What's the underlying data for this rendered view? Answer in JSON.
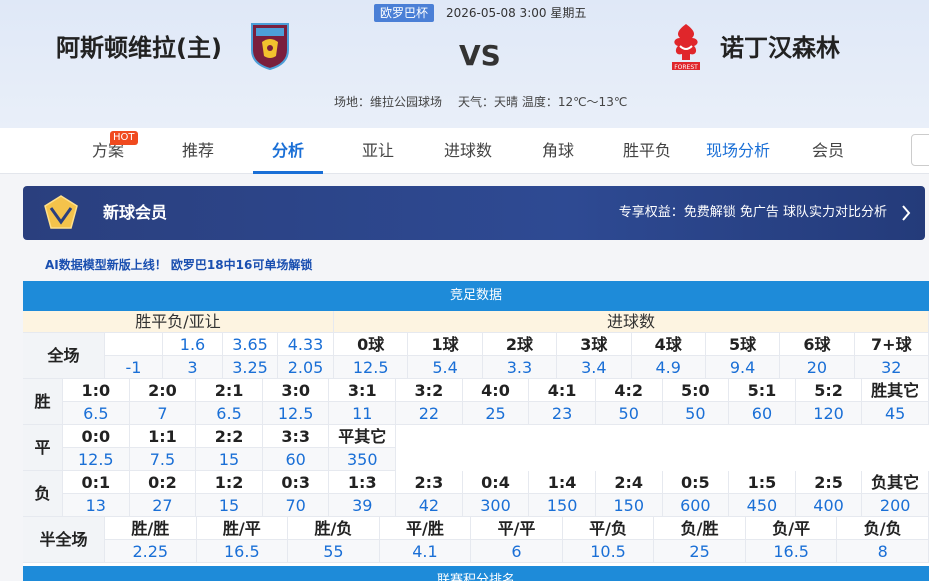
{
  "match": {
    "league": "欧罗巴杯",
    "datetime": "2026-05-08 3:00 星期五",
    "home": "阿斯顿维拉(主)",
    "away": "诺丁汉森林",
    "vs": "VS",
    "venue": "场地：维拉公园球场",
    "weather": "天气：天晴 温度：12℃～13℃"
  },
  "nav": {
    "hot": "HOT",
    "tabs": [
      "方案",
      "推荐",
      "分析",
      "亚让",
      "进球数",
      "角球",
      "胜平负",
      "现场分析",
      "会员"
    ],
    "active": "分析"
  },
  "vip": {
    "title": "新球会员",
    "perks": "专享权益：免费解锁 免广告 球队实力对比分析"
  },
  "promo": "AI数据模型新版上线！ 欧罗巴18中16可单场解锁",
  "jingzu": {
    "title": "竞足数据",
    "spf_header": "胜平负/亚让",
    "goals_header": "进球数",
    "full_label": "全场",
    "spf_row1": [
      "",
      "1.6",
      "3.65",
      "4.33"
    ],
    "spf_row2": [
      "-1",
      "3",
      "3.25",
      "2.05"
    ],
    "goal_labels": [
      "0球",
      "1球",
      "2球",
      "3球",
      "4球",
      "5球",
      "6球",
      "7+球"
    ],
    "goal_odds": [
      "12.5",
      "5.4",
      "3.3",
      "3.4",
      "4.9",
      "9.4",
      "20",
      "32"
    ],
    "win_label": "胜",
    "win_scores": [
      "1:0",
      "2:0",
      "2:1",
      "3:0",
      "3:1",
      "3:2",
      "4:0",
      "4:1",
      "4:2",
      "5:0",
      "5:1",
      "5:2",
      "胜其它"
    ],
    "win_odds": [
      "6.5",
      "7",
      "6.5",
      "12.5",
      "11",
      "22",
      "25",
      "23",
      "50",
      "50",
      "60",
      "120",
      "45"
    ],
    "draw_label": "平",
    "draw_scores": [
      "0:0",
      "1:1",
      "2:2",
      "3:3",
      "平其它"
    ],
    "draw_odds": [
      "12.5",
      "7.5",
      "15",
      "60",
      "350"
    ],
    "lose_label": "负",
    "lose_scores": [
      "0:1",
      "0:2",
      "1:2",
      "0:3",
      "1:3",
      "2:3",
      "0:4",
      "1:4",
      "2:4",
      "0:5",
      "1:5",
      "2:5",
      "负其它"
    ],
    "lose_odds": [
      "13",
      "27",
      "15",
      "70",
      "39",
      "42",
      "300",
      "150",
      "150",
      "600",
      "450",
      "400",
      "200"
    ],
    "half_label": "半全场",
    "half_labels": [
      "胜/胜",
      "胜/平",
      "胜/负",
      "平/胜",
      "平/平",
      "平/负",
      "负/胜",
      "负/平",
      "负/负"
    ],
    "half_odds": [
      "2.25",
      "16.5",
      "55",
      "4.1",
      "6",
      "10.5",
      "25",
      "16.5",
      "8"
    ],
    "next_title": "联赛积分排名"
  },
  "colors": {
    "accent": "#1a6fd6",
    "header_bar": "#1e8bd9",
    "hot": "#f04a1f",
    "vip_bg": "#2a3f7e"
  }
}
